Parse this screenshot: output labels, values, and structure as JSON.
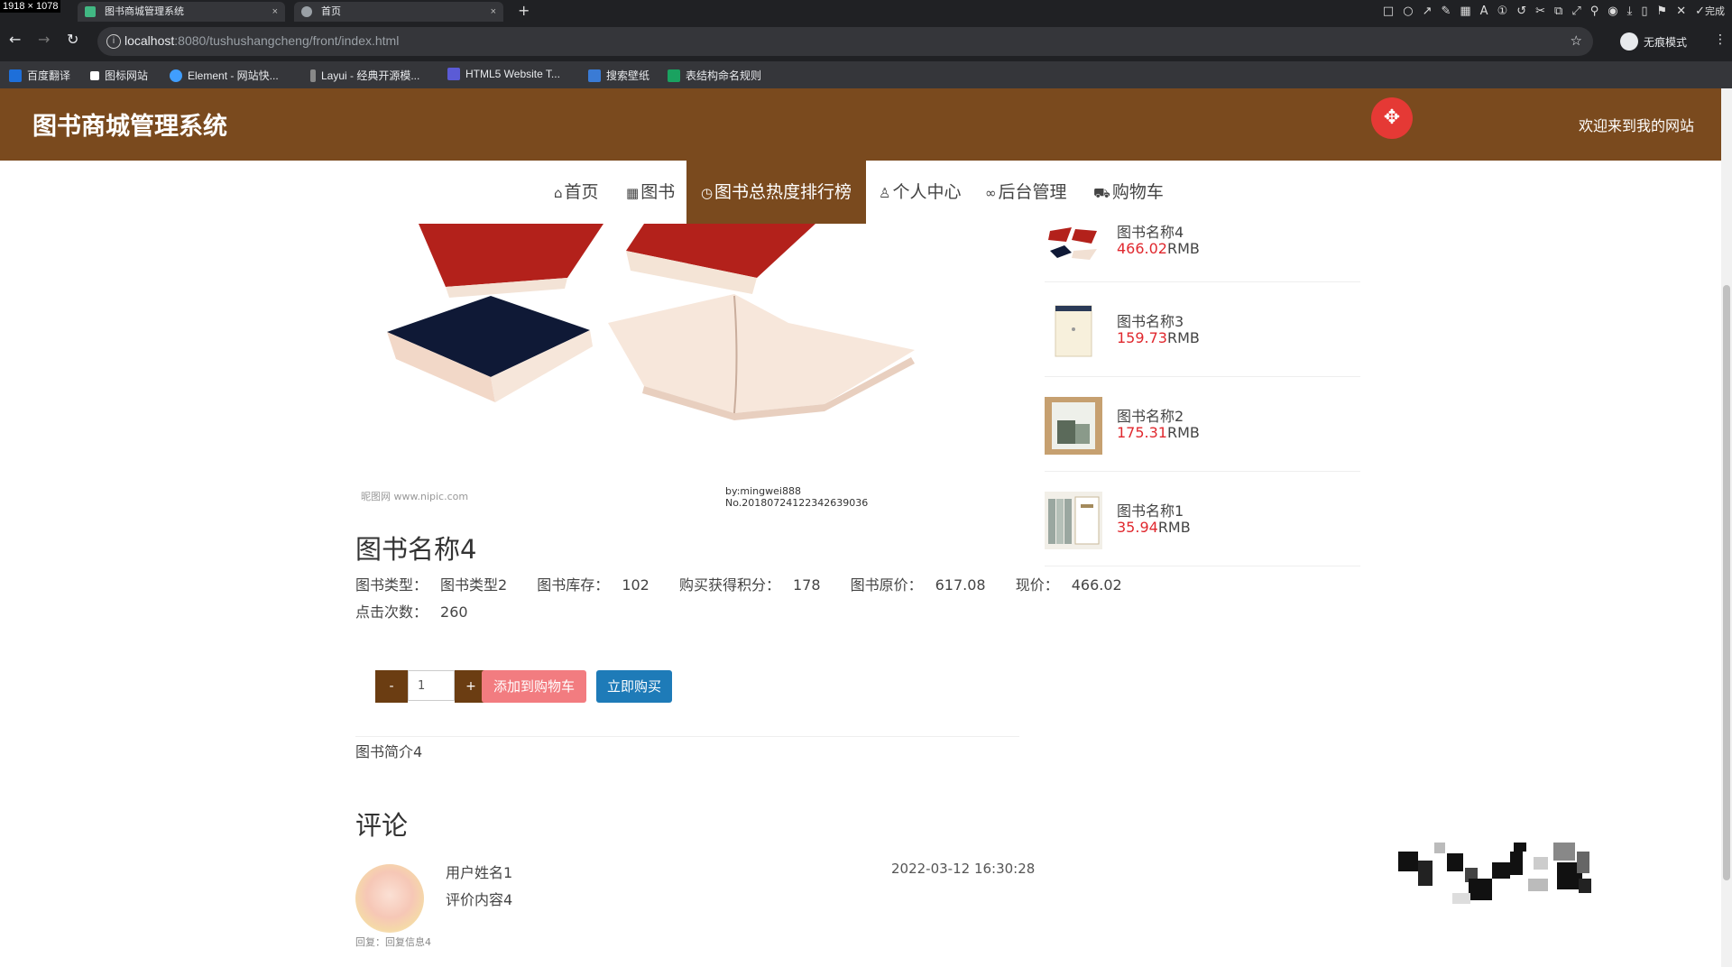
{
  "browser": {
    "dimensions_badge": "1918 × 1078",
    "tabs": [
      {
        "title": "图书商城管理系统",
        "close": "×"
      },
      {
        "title": "首页",
        "close": "×"
      }
    ],
    "new_tab": "+",
    "url_host": "localhost",
    "url_rest": ":8080/tushushangcheng/front/index.html",
    "incognito_label": "无痕模式",
    "done_label": "完成",
    "bookmarks": [
      {
        "label": "百度翻译",
        "color": "#1e6fd9"
      },
      {
        "label": "图标网站",
        "color": "#ffffff"
      },
      {
        "label": "Element - 网站快...",
        "color": "#409eff"
      },
      {
        "label": "Layui - 经典开源模...",
        "color": "#cccccc"
      },
      {
        "label": "HTML5 Website T...",
        "color": "#5b5bd6"
      },
      {
        "label": "搜索壁纸",
        "color": "#3a7bd5"
      },
      {
        "label": "表结构命名规则",
        "color": "#1aa260"
      }
    ]
  },
  "header": {
    "site_title": "图书商城管理系统",
    "welcome": "欢迎来到我的网站",
    "brand_color": "#7a4a1e"
  },
  "nav": [
    {
      "label": "首页",
      "icon": "home-icon"
    },
    {
      "label": "图书",
      "icon": "grid-icon"
    },
    {
      "label": "图书总热度排行榜",
      "icon": "clock-icon",
      "active": true
    },
    {
      "label": "个人中心",
      "icon": "user-icon"
    },
    {
      "label": "后台管理",
      "icon": "link-icon"
    },
    {
      "label": "购物车",
      "icon": "cart-icon"
    }
  ],
  "book": {
    "watermark_left": "昵图网 www.nipic.com",
    "watermark_right": "by:mingwei888 No.20180724122342639036",
    "title": "图书名称4",
    "type_label": "图书类型：",
    "type_value": "图书类型2",
    "stock_label": "图书库存：",
    "stock_value": "102",
    "points_label": "购买获得积分：",
    "points_value": "178",
    "orig_price_label": "图书原价：",
    "orig_price_value": "617.08",
    "price_label": "现价：",
    "price_value": "466.02",
    "clicks_label": "点击次数：",
    "clicks_value": "260",
    "quantity": "1",
    "minus": "-",
    "plus": "+",
    "add_to_cart": "添加到购物车",
    "buy_now": "立即购买",
    "intro": "图书简介4"
  },
  "comments": {
    "title": "评论",
    "items": [
      {
        "user": "用户姓名1",
        "content": "评价内容4",
        "time": "2022-03-12 16:30:28",
        "reply": "回复：回复信息4"
      }
    ]
  },
  "sidebar": [
    {
      "name": "图书名称4",
      "price": "466.02",
      "unit": "RMB"
    },
    {
      "name": "图书名称3",
      "price": "159.73",
      "unit": "RMB"
    },
    {
      "name": "图书名称2",
      "price": "175.31",
      "unit": "RMB"
    },
    {
      "name": "图书名称1",
      "price": "35.94",
      "unit": "RMB"
    }
  ]
}
